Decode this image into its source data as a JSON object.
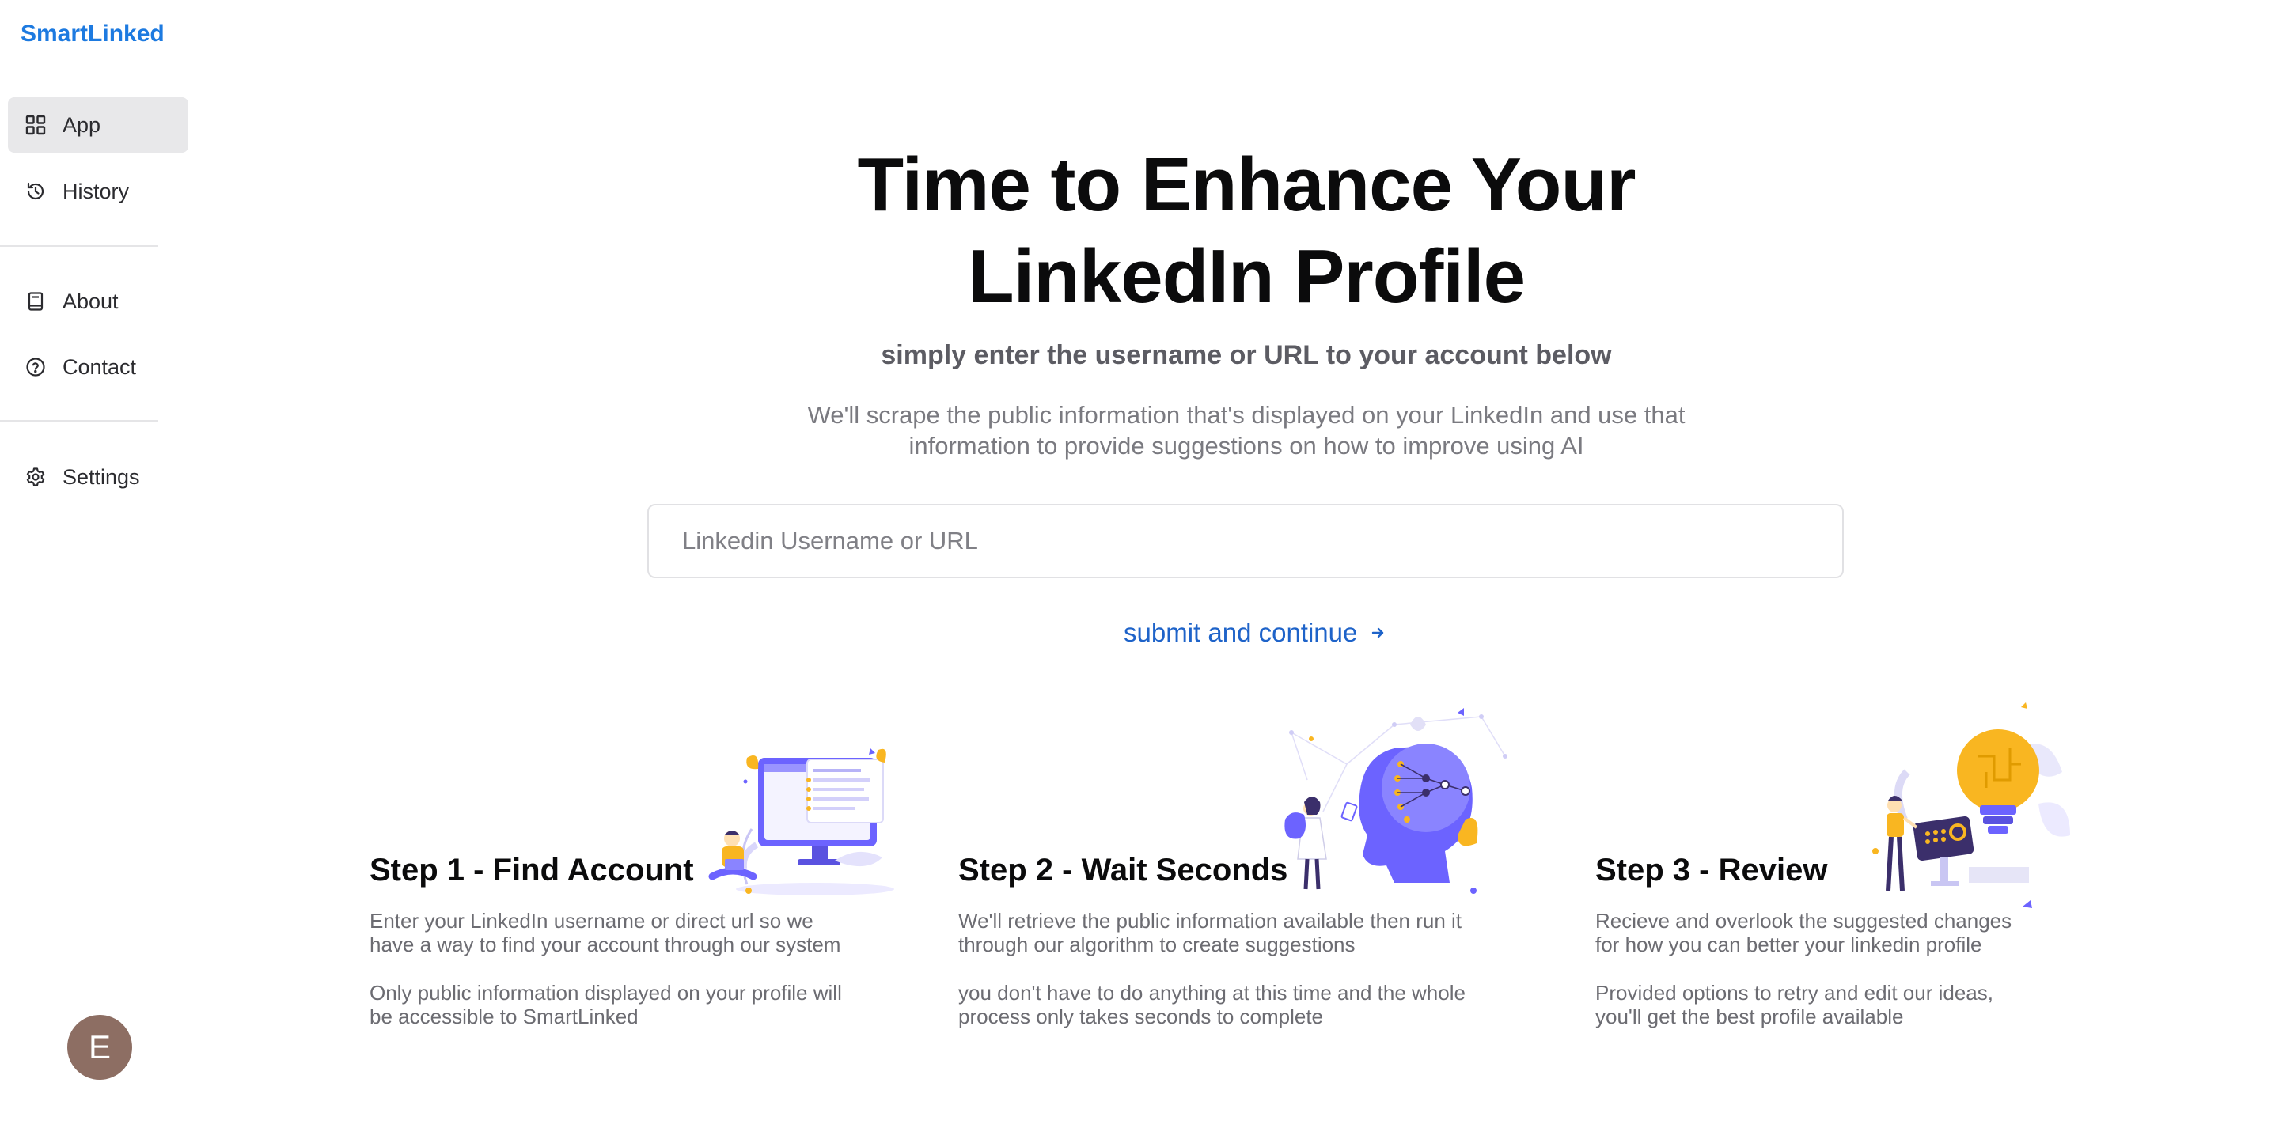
{
  "brand": "SmartLinked",
  "nav": {
    "app": "App",
    "history": "History",
    "about": "About",
    "contact": "Contact",
    "settings": "Settings"
  },
  "avatar_initial": "E",
  "hero": {
    "title_line1": "Time to Enhance Your",
    "title_line2": "LinkedIn Profile",
    "subtitle": "simply enter the username or URL to your account below",
    "desc_line1": "We'll scrape the public information that's displayed on your LinkedIn and use that",
    "desc_line2": "information to provide suggestions on how to improve using AI"
  },
  "search": {
    "placeholder": "Linkedin Username or URL",
    "value": ""
  },
  "submit_label": "submit and continue",
  "steps": [
    {
      "title": "Step 1 - Find Account",
      "p1_line1": "Enter your LinkedIn username or direct url so we",
      "p1_line2": "have a way to find your account through our system",
      "p2_line1": "Only public information displayed on your profile will",
      "p2_line2": "be accessible to SmartLinked"
    },
    {
      "title": "Step 2 - Wait Seconds",
      "p1_line1": "We'll retrieve the public information available then run it",
      "p1_line2": "through our algorithm to create suggestions",
      "p2_line1": "you don't have to do anything at this time and the whole",
      "p2_line2": "process only takes seconds to complete"
    },
    {
      "title": "Step 3 - Review",
      "p1_line1": "Recieve and overlook the suggested changes",
      "p1_line2": "for how you can better your linkedin profile",
      "p2_line1": "Provided options to retry and edit our ideas,",
      "p2_line2": "you'll get the best profile available"
    }
  ],
  "colors": {
    "brand": "#1d7ae0",
    "link": "#1e63c9",
    "illustration_purple": "#6c63ff",
    "illustration_yellow": "#f9b621",
    "avatar": "#8d6e63"
  },
  "icons": {
    "app": "grid-icon",
    "history": "history-icon",
    "about": "book-icon",
    "contact": "help-circle-icon",
    "settings": "gear-icon",
    "submit": "arrow-right-icon"
  }
}
